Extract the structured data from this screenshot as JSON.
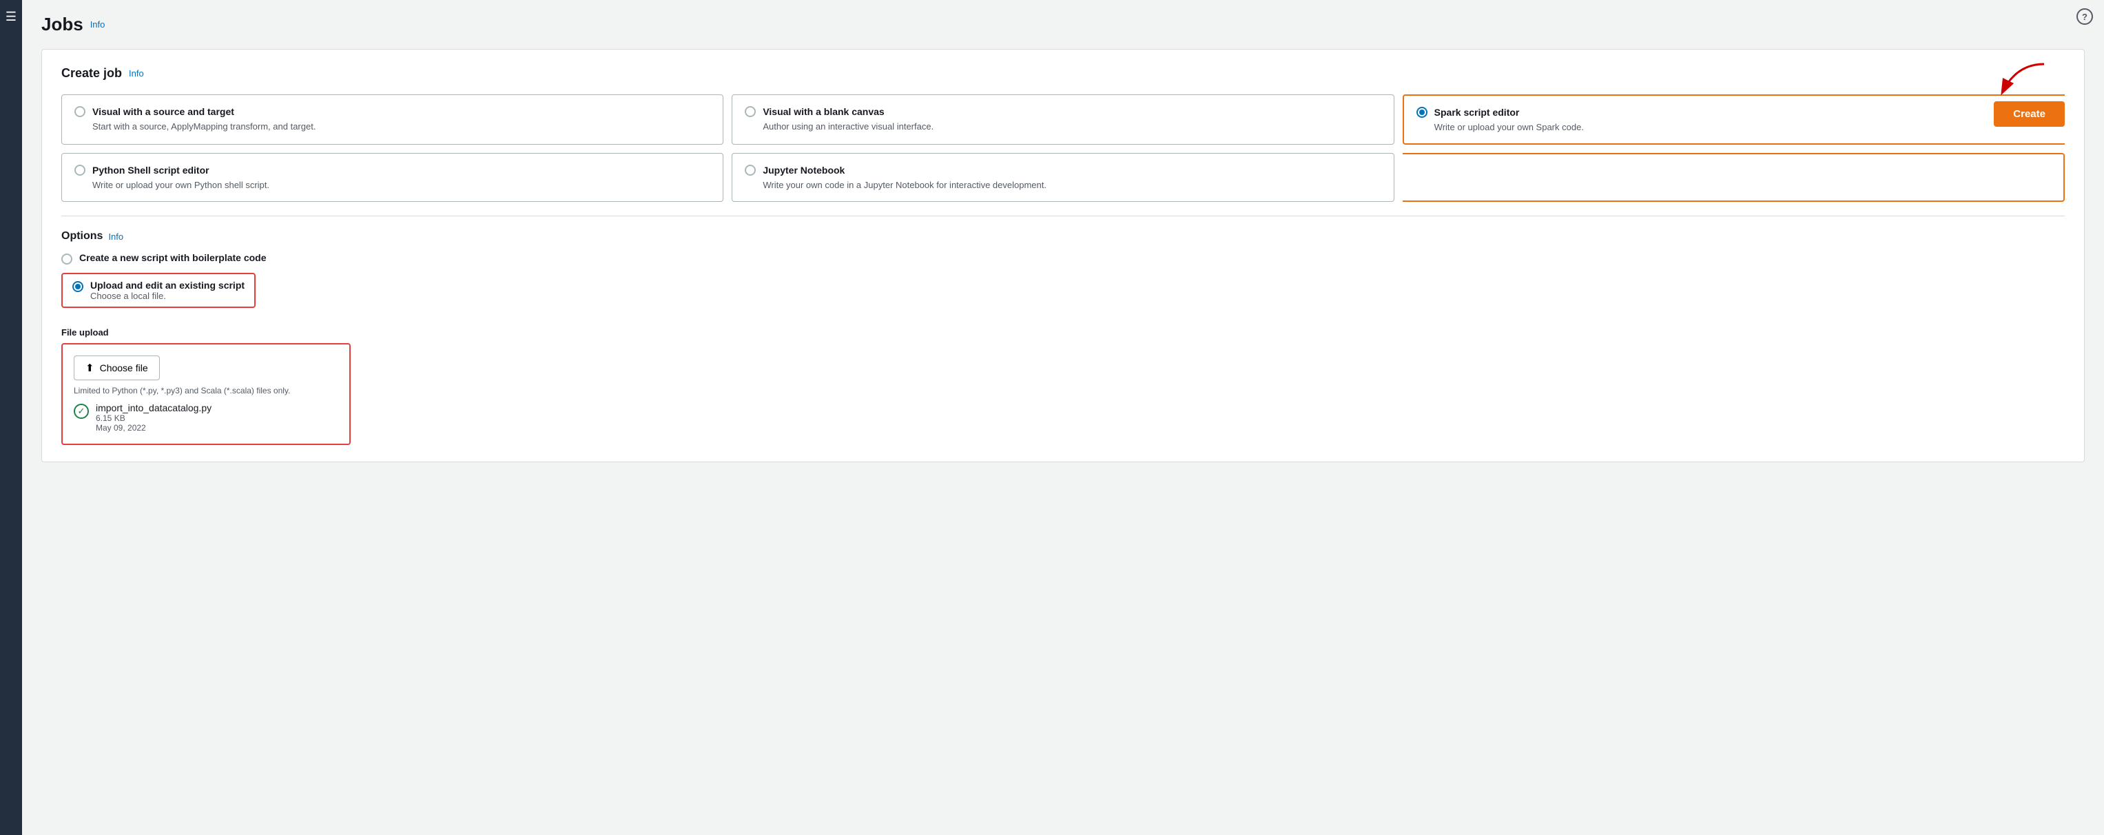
{
  "page": {
    "title": "Jobs",
    "info_label": "Info"
  },
  "create_job": {
    "section_title": "Create job",
    "section_info": "Info",
    "create_button": "Create"
  },
  "job_types": [
    {
      "id": "visual_source_target",
      "label": "Visual with a source and target",
      "description": "Start with a source, ApplyMapping transform, and target.",
      "selected": false
    },
    {
      "id": "visual_blank",
      "label": "Visual with a blank canvas",
      "description": "Author using an interactive visual interface.",
      "selected": false
    },
    {
      "id": "spark_script",
      "label": "Spark script editor",
      "description": "Write or upload your own Spark code.",
      "selected": true
    },
    {
      "id": "python_shell",
      "label": "Python Shell script editor",
      "description": "Write or upload your own Python shell script.",
      "selected": false
    },
    {
      "id": "jupyter",
      "label": "Jupyter Notebook",
      "description": "Write your own code in a Jupyter Notebook for interactive development.",
      "selected": false
    }
  ],
  "options": {
    "title": "Options",
    "info_label": "Info",
    "radio_items": [
      {
        "id": "new_script",
        "label": "Create a new script with boilerplate code",
        "sublabel": "",
        "selected": false
      },
      {
        "id": "upload_script",
        "label": "Upload and edit an existing script",
        "sublabel": "Choose a local file.",
        "selected": true
      }
    ]
  },
  "file_upload": {
    "label": "File upload",
    "choose_button": "Choose file",
    "limit_text": "Limited to Python (*.py, *.py3) and Scala (*.scala) files only.",
    "file_name": "import_into_datacatalog.py",
    "file_size": "6.15 KB",
    "file_date": "May 09, 2022"
  },
  "icons": {
    "menu": "☰",
    "info": "?",
    "upload": "⬆",
    "check": "✓"
  }
}
